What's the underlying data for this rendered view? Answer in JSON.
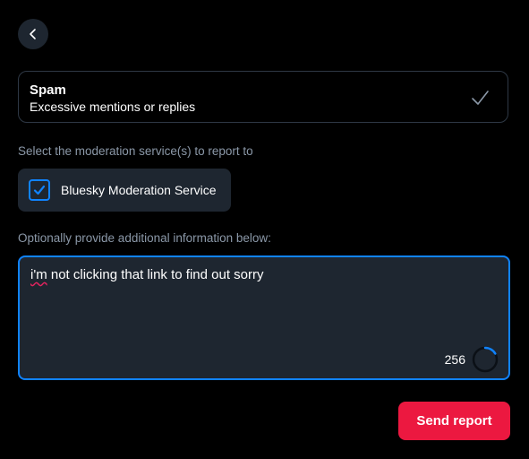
{
  "reason": {
    "title": "Spam",
    "description": "Excessive mentions or replies"
  },
  "services": {
    "label": "Select the moderation service(s) to report to",
    "items": [
      {
        "label": "Bluesky Moderation Service",
        "checked": true
      }
    ]
  },
  "details": {
    "label": "Optionally provide additional information below:",
    "misspelled_word": "i'm",
    "text_rest": " not clicking that link to find out sorry",
    "remaining_chars": "256"
  },
  "actions": {
    "send_label": "Send report"
  },
  "colors": {
    "background": "#000000",
    "surface": "#1e2630",
    "accent": "#1083fe",
    "danger": "#ec1840",
    "muted_text": "#8b98a8"
  },
  "icons": {
    "back": "chevron-left-icon",
    "selected": "check-icon",
    "checkbox": "checkbox-checked-icon",
    "progress": "progress-ring-icon"
  }
}
